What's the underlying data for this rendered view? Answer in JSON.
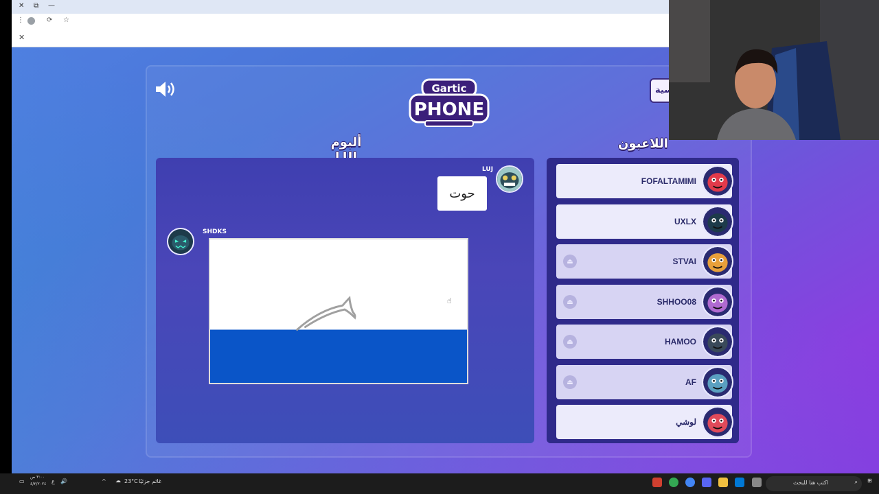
{
  "browser": {
    "close_tab": "✕",
    "window_buttons": [
      "✕",
      "⧉",
      "—"
    ]
  },
  "game": {
    "logo_line1": "Gartic",
    "logo_line2": "PHONE",
    "settings_label": "سية",
    "album_title": "ألبوم LUJ",
    "players_title": "اللاعبون",
    "album": {
      "word_author": "LUJ",
      "word": "حوت",
      "drawing_author": "SHDKS"
    },
    "players": [
      {
        "name": "FOFALTAMIMI",
        "kick": false,
        "bright": true,
        "avatar_color": "#e23a4a"
      },
      {
        "name": "UXLX",
        "kick": false,
        "bright": true,
        "avatar_color": "#1d3b4a"
      },
      {
        "name": "STVAI",
        "kick": true,
        "bright": false,
        "avatar_color": "#e8a03a"
      },
      {
        "name": "SHHOO08",
        "kick": true,
        "bright": false,
        "avatar_color": "#b06ad0"
      },
      {
        "name": "HAMOO",
        "kick": true,
        "bright": false,
        "avatar_color": "#3a4a5a"
      },
      {
        "name": "AF",
        "kick": true,
        "bright": false,
        "avatar_color": "#5aa0c0"
      },
      {
        "name": "لوشي",
        "kick": false,
        "bright": true,
        "avatar_color": "#e04a5a"
      }
    ]
  },
  "taskbar": {
    "time": "٣:٠٠ ص",
    "date": "٤/٢/٢٠٢٤",
    "weather": "23°C",
    "weather_label": "غائم جزئيًا",
    "search_placeholder": "اكتب هنا للبحث",
    "lang": "ع"
  }
}
